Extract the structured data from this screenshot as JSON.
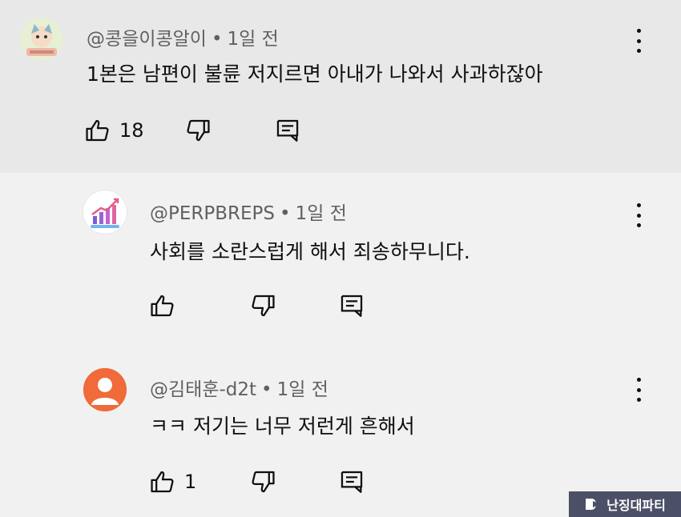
{
  "comments": [
    {
      "author": "@콩을이콩알이",
      "time": "1일 전",
      "text": "1본은 남편이 불륜 저지르면 아내가 나와서 사과하잖아",
      "likes": "18"
    },
    {
      "author": "@PERPBREPS",
      "time": "1일 전",
      "text": "사회를 소란스럽게 해서 죄송하무니다.",
      "likes": ""
    },
    {
      "author": "@김태훈-d2t",
      "time": "1일 전",
      "text": "ㅋㅋ 저기는 너무 저런게 흔해서",
      "likes": "1"
    }
  ],
  "separator": "•",
  "icons": {
    "like": "thumbs-up-icon",
    "dislike": "thumbs-down-icon",
    "reply": "reply-icon",
    "more": "more-vertical-icon"
  },
  "watermark": "난징대파티",
  "colors": {
    "top_bg": "#e8e8e8",
    "reply_bg": "#f1f1f1",
    "meta_text": "#606060",
    "default_avatar": "#f06a3a"
  }
}
